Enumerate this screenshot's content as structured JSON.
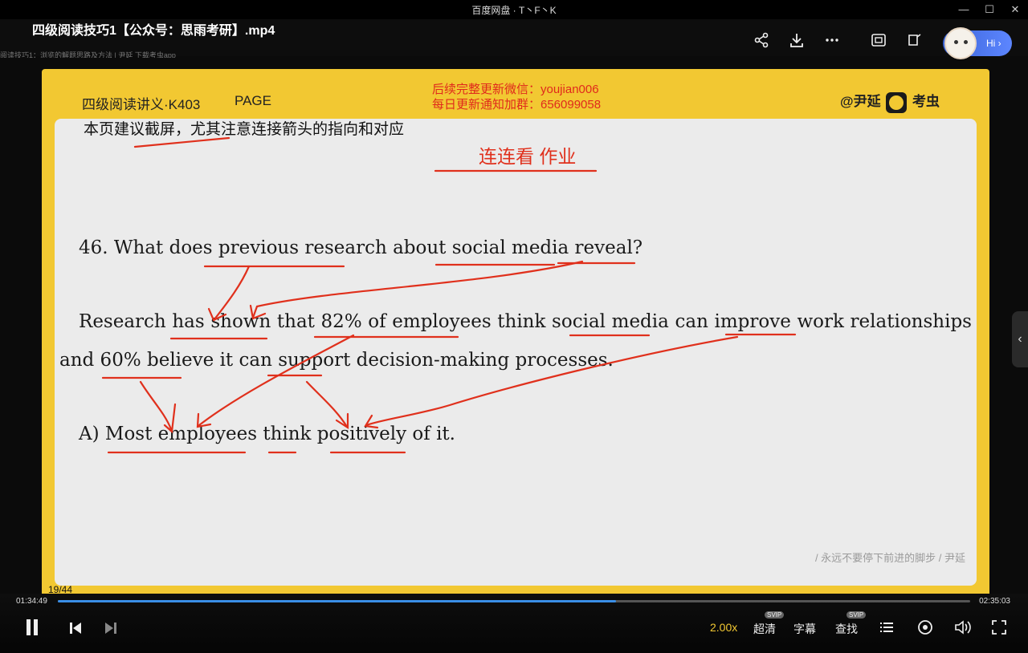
{
  "window": {
    "app_title": "百度网盘 · T丶F丶K",
    "minimize": "—",
    "maximize": "☐",
    "close": "✕"
  },
  "video": {
    "title": "四级阅读技巧1【公众号：思雨考研】.mp4",
    "subline": "阅读技巧1：浏览的解题思路及方法 | 尹延                                                                                                                                                                                  下载考虫app"
  },
  "assistant": {
    "label": "Hi ›"
  },
  "slide": {
    "header_left": "四级阅读讲义·K403",
    "header_page": "PAGE",
    "promo_line1": "后续完整更新微信：youjian006",
    "promo_line2": "每日更新通知加群：656099058",
    "brand_author": "@尹延",
    "brand_name": "考虫",
    "note": "本页建议截屏，尤其注意连接箭头的指向和对应",
    "homework": "连连看  作业",
    "question": "46. What does previous research about social media reveal?",
    "passage_line1": "Research has shown that 82% of employees think social media can improve work relationships",
    "passage_line2": "and 60% believe it can support decision-making processes.",
    "answer": "A) Most employees think positively of it.",
    "motto": "/ 永远不要停下前进的脚步 /  尹延",
    "page_counter": "19/44"
  },
  "player": {
    "current_time": "01:34:49",
    "total_time": "02:35:03",
    "progress": 0.612,
    "speed": "2.00x",
    "quality": "超清",
    "quality_tag": "SVIP",
    "subtitles": "字幕",
    "search": "查找",
    "search_tag": "SVIP"
  },
  "colors": {
    "slide_yellow": "#f2c832",
    "annotation_red": "#e0301c",
    "progress_blue": "#3a8ee6"
  }
}
